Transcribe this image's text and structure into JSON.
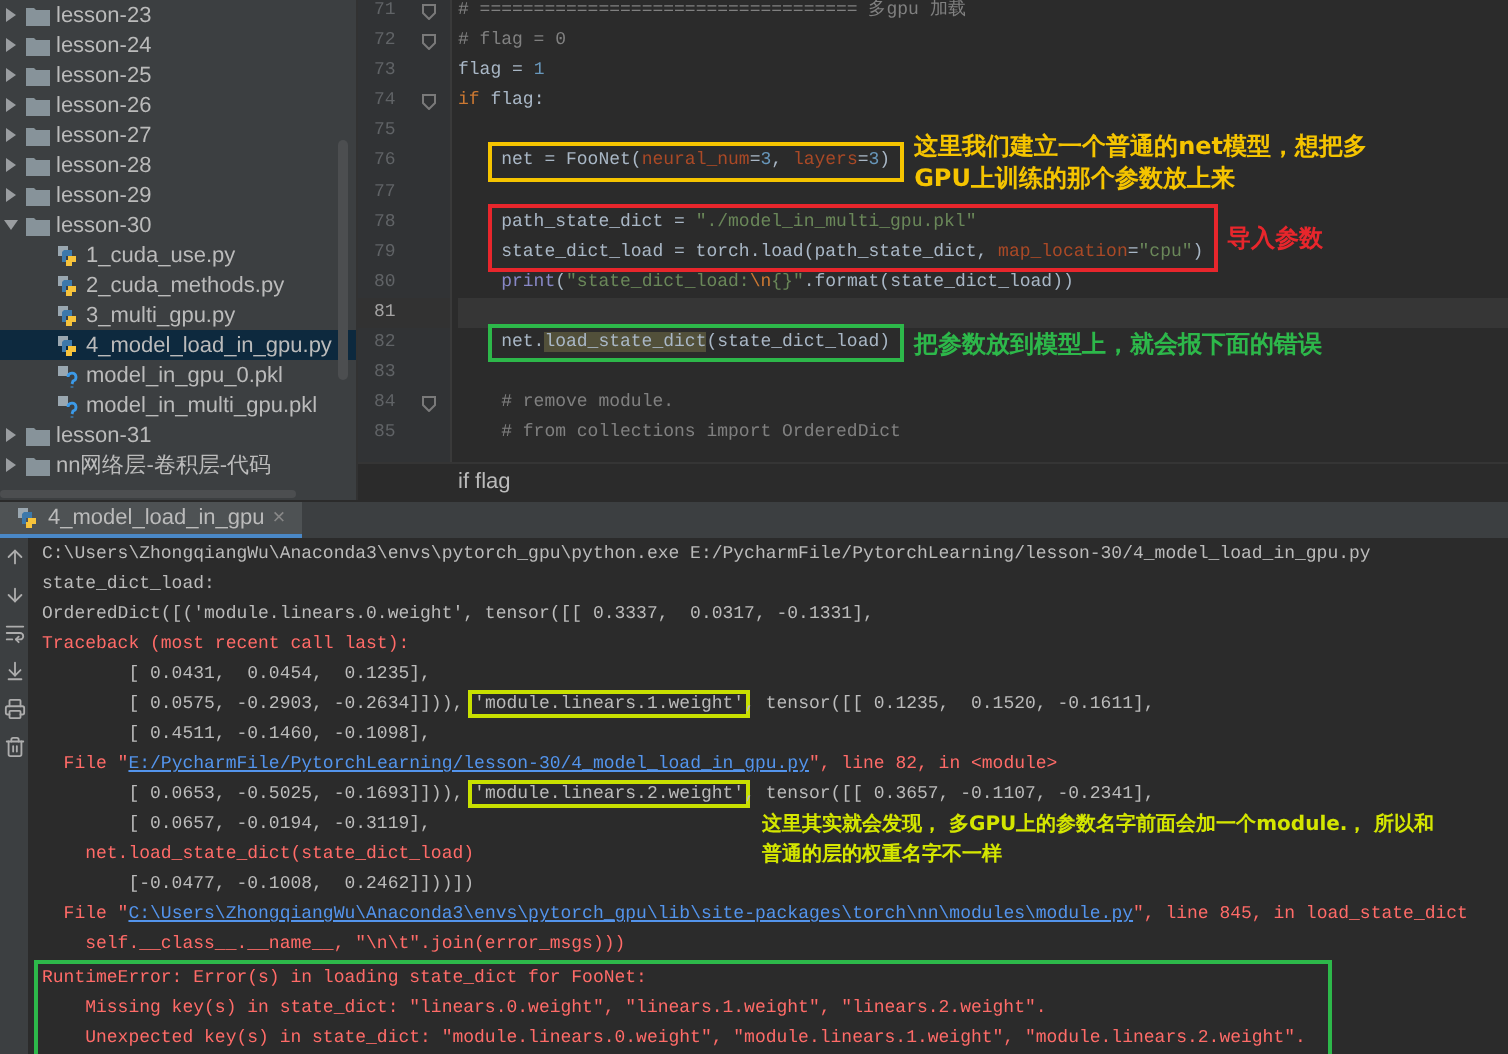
{
  "project_tree": [
    {
      "label": "lesson-23",
      "kind": "folder",
      "expanded": false,
      "selected": false
    },
    {
      "label": "lesson-24",
      "kind": "folder",
      "expanded": false,
      "selected": false
    },
    {
      "label": "lesson-25",
      "kind": "folder",
      "expanded": false,
      "selected": false
    },
    {
      "label": "lesson-26",
      "kind": "folder",
      "expanded": false,
      "selected": false
    },
    {
      "label": "lesson-27",
      "kind": "folder",
      "expanded": false,
      "selected": false
    },
    {
      "label": "lesson-28",
      "kind": "folder",
      "expanded": false,
      "selected": false
    },
    {
      "label": "lesson-29",
      "kind": "folder",
      "expanded": false,
      "selected": false
    },
    {
      "label": "lesson-30",
      "kind": "folder",
      "expanded": true,
      "selected": false,
      "children": [
        {
          "label": "1_cuda_use.py",
          "kind": "python",
          "selected": false
        },
        {
          "label": "2_cuda_methods.py",
          "kind": "python",
          "selected": false
        },
        {
          "label": "3_multi_gpu.py",
          "kind": "python",
          "selected": false
        },
        {
          "label": "4_model_load_in_gpu.py",
          "kind": "python",
          "selected": true
        },
        {
          "label": "model_in_gpu_0.pkl",
          "kind": "pickle",
          "selected": false
        },
        {
          "label": "model_in_multi_gpu.pkl",
          "kind": "pickle",
          "selected": false
        }
      ]
    },
    {
      "label": "lesson-31",
      "kind": "folder",
      "expanded": false,
      "selected": false
    },
    {
      "label": "nn网络层-卷积层-代码",
      "kind": "folder",
      "expanded": false,
      "selected": false
    }
  ],
  "editor": {
    "blocks": [
      {
        "kind": "plain",
        "lines": [
          {
            "number": "71",
            "fold": true,
            "current": false,
            "tokens": [
              {
                "kind": "comment",
                "t": "# =================================== 多gpu 加载"
              }
            ]
          },
          {
            "number": "72",
            "fold": true,
            "current": false,
            "tokens": [
              {
                "kind": "comment",
                "t": "# flag = 0"
              }
            ]
          },
          {
            "number": "73",
            "fold": false,
            "current": false,
            "tokens": [
              {
                "kind": "plain",
                "t": "flag = "
              },
              {
                "kind": "number",
                "t": "1"
              }
            ]
          },
          {
            "number": "74",
            "fold": true,
            "current": false,
            "tokens": [
              {
                "kind": "keyword",
                "t": "if"
              },
              {
                "kind": "plain",
                "t": " flag:"
              }
            ]
          },
          {
            "number": "75",
            "fold": false,
            "current": false
          }
        ]
      },
      {
        "kind": "frame",
        "color": "#f5c400",
        "note": "这里我们建立一个普通的net模型，想把多GPU上训练的那个参数放上来",
        "lines": [
          {
            "number": "76",
            "fold": false,
            "current": false,
            "tokens": [
              {
                "kind": "plain",
                "t": "net = FooNet("
              },
              {
                "kind": "param",
                "t": "neural_num"
              },
              {
                "kind": "plain",
                "t": "="
              },
              {
                "kind": "number",
                "t": "3"
              },
              {
                "kind": "plain",
                "t": ", "
              },
              {
                "kind": "param",
                "t": "layers"
              },
              {
                "kind": "plain",
                "t": "="
              },
              {
                "kind": "number",
                "t": "3"
              },
              {
                "kind": "plain",
                "t": ")"
              }
            ]
          }
        ]
      },
      {
        "kind": "plain",
        "lines": [
          {
            "number": "77",
            "fold": false,
            "current": false
          }
        ]
      },
      {
        "kind": "frame",
        "color": "#e8262c",
        "note": "导入参数",
        "lines": [
          {
            "number": "78",
            "fold": false,
            "current": false,
            "tokens": [
              {
                "kind": "plain",
                "t": "path_state_dict = "
              },
              {
                "kind": "string",
                "t": "\"./model_in_multi_gpu.pkl\""
              }
            ]
          },
          {
            "number": "79",
            "fold": false,
            "current": false,
            "tokens": [
              {
                "kind": "plain",
                "t": "state_dict_load = torch.load(path_state_dict, "
              },
              {
                "kind": "param",
                "t": "map_location"
              },
              {
                "kind": "plain",
                "t": "="
              },
              {
                "kind": "string",
                "t": "\"cpu\""
              },
              {
                "kind": "plain",
                "t": ")"
              }
            ]
          }
        ]
      },
      {
        "kind": "plain",
        "lines": [
          {
            "number": "80",
            "fold": false,
            "current": false,
            "tokens": [
              {
                "kind": "builtin",
                "t": "    print"
              },
              {
                "kind": "plain",
                "t": "("
              },
              {
                "kind": "string",
                "t": "\"state_dict_load:"
              },
              {
                "kind": "escape",
                "t": "\\n"
              },
              {
                "kind": "string",
                "t": "{}\""
              },
              {
                "kind": "plain",
                "t": ".format(state_dict_load))"
              }
            ]
          },
          {
            "number": "81",
            "fold": false,
            "current": true
          }
        ]
      },
      {
        "kind": "frame",
        "color": "#2db84a",
        "note": "把参数放到模型上，就会报下面的错误",
        "lines": [
          {
            "number": "82",
            "fold": false,
            "current": false,
            "tokens": [
              {
                "kind": "plain",
                "t": "net."
              },
              {
                "kind": "match",
                "t": "load_state_dict"
              },
              {
                "kind": "plain",
                "t": "(state_dict_load)"
              }
            ]
          }
        ]
      },
      {
        "kind": "plain",
        "lines": [
          {
            "number": "83",
            "fold": false,
            "current": false
          },
          {
            "number": "84",
            "fold": true,
            "current": false,
            "tokens": [
              {
                "kind": "comment",
                "t": "    # remove module."
              }
            ]
          },
          {
            "number": "85",
            "fold": false,
            "current": false,
            "tokens": [
              {
                "kind": "comment",
                "t": "    # from collections import OrderedDict"
              }
            ]
          }
        ]
      }
    ],
    "breadcrumb": "if flag"
  },
  "run_tab": {
    "label": "4_model_load_in_gpu",
    "close": "×",
    "selected": true
  },
  "console": {
    "blocks": [
      {
        "kind": "plain",
        "lines": [
          {
            "tokens": [
              {
                "kind": "plain",
                "t": "C:\\Users\\ZhongqiangWu\\Anaconda3\\envs\\pytorch_gpu\\python.exe E:/PycharmFile/PytorchLearning/lesson-30/4_model_load_in_gpu.py"
              }
            ]
          },
          {
            "tokens": [
              {
                "kind": "plain",
                "t": "state_dict_load:"
              }
            ]
          },
          {
            "tokens": [
              {
                "kind": "plain",
                "t": "OrderedDict([('module.linears.0.weight', tensor([[ 0.3337,  0.0317, -0.1331],"
              }
            ]
          },
          {
            "tokens": [
              {
                "kind": "error",
                "t": "Traceback (most recent call last):"
              }
            ]
          },
          {
            "tokens": [
              {
                "kind": "plain",
                "t": "        [ 0.0431,  0.0454,  0.1235],"
              }
            ]
          },
          {
            "tokens": [
              {
                "kind": "plain",
                "t": "        [ 0.0575, -0.2903, -0.2634]])), "
              },
              {
                "kind": "framed",
                "t": "'module.linears.1.weight'"
              },
              {
                "kind": "plain",
                "t": ", tensor([[ 0.1235,  0.1520, -0.1611],"
              }
            ]
          },
          {
            "tokens": [
              {
                "kind": "plain",
                "t": "        [ 0.4511, -0.1460, -0.1098],"
              }
            ]
          },
          {
            "tokens": [
              {
                "kind": "error",
                "t": "  File \""
              },
              {
                "kind": "link",
                "t": "E:/PycharmFile/PytorchLearning/lesson-30/4_model_load_in_gpu.py"
              },
              {
                "kind": "error",
                "t": "\", line 82, in <module>"
              }
            ]
          },
          {
            "tokens": [
              {
                "kind": "plain",
                "t": "        [ 0.0653, -0.5025, -0.1693]])), "
              },
              {
                "kind": "framed",
                "t": "'module.linears.2.weight'"
              },
              {
                "kind": "plain",
                "t": ", tensor([[ 0.3657, -0.1107, -0.2341],"
              }
            ]
          },
          {
            "tokens": [
              {
                "kind": "plain",
                "t": "        [ 0.0657, -0.0194, -0.3119],"
              }
            ],
            "note": "这里其实就会发现， 多GPU上的参数名字前面会加一个module.， 所以和普通的层的权重名字不一样"
          },
          {
            "tokens": [
              {
                "kind": "error",
                "t": "    net.load_state_dict(state_dict_load)"
              }
            ]
          },
          {
            "tokens": [
              {
                "kind": "plain",
                "t": "        [-0.0477, -0.1008,  0.2462]]))])"
              }
            ]
          },
          {
            "tokens": [
              {
                "kind": "error",
                "t": "  File \""
              },
              {
                "kind": "link",
                "t": "C:\\Users\\ZhongqiangWu\\Anaconda3\\envs\\pytorch_gpu\\lib\\site-packages\\torch\\nn\\modules\\module.py"
              },
              {
                "kind": "error",
                "t": "\", line 845, in load_state_dict"
              }
            ]
          },
          {
            "tokens": [
              {
                "kind": "error",
                "t": "    self.__class__.__name__, \"\\n\\t\".join(error_msgs)))"
              }
            ]
          }
        ]
      },
      {
        "kind": "frame",
        "color": "#2db84a",
        "lines": [
          {
            "tokens": [
              {
                "kind": "error",
                "t": "RuntimeError: Error(s) in loading state_dict for FooNet:"
              }
            ]
          },
          {
            "tokens": [
              {
                "kind": "error",
                "t": "    Missing key(s) in state_dict: \"linears.0.weight\", \"linears.1.weight\", \"linears.2.weight\". "
              }
            ]
          },
          {
            "tokens": [
              {
                "kind": "error",
                "t": "    Unexpected key(s) in state_dict: \"module.linears.0.weight\", \"module.linears.1.weight\", \"module.linears.2.weight\". "
              }
            ]
          }
        ]
      }
    ]
  }
}
